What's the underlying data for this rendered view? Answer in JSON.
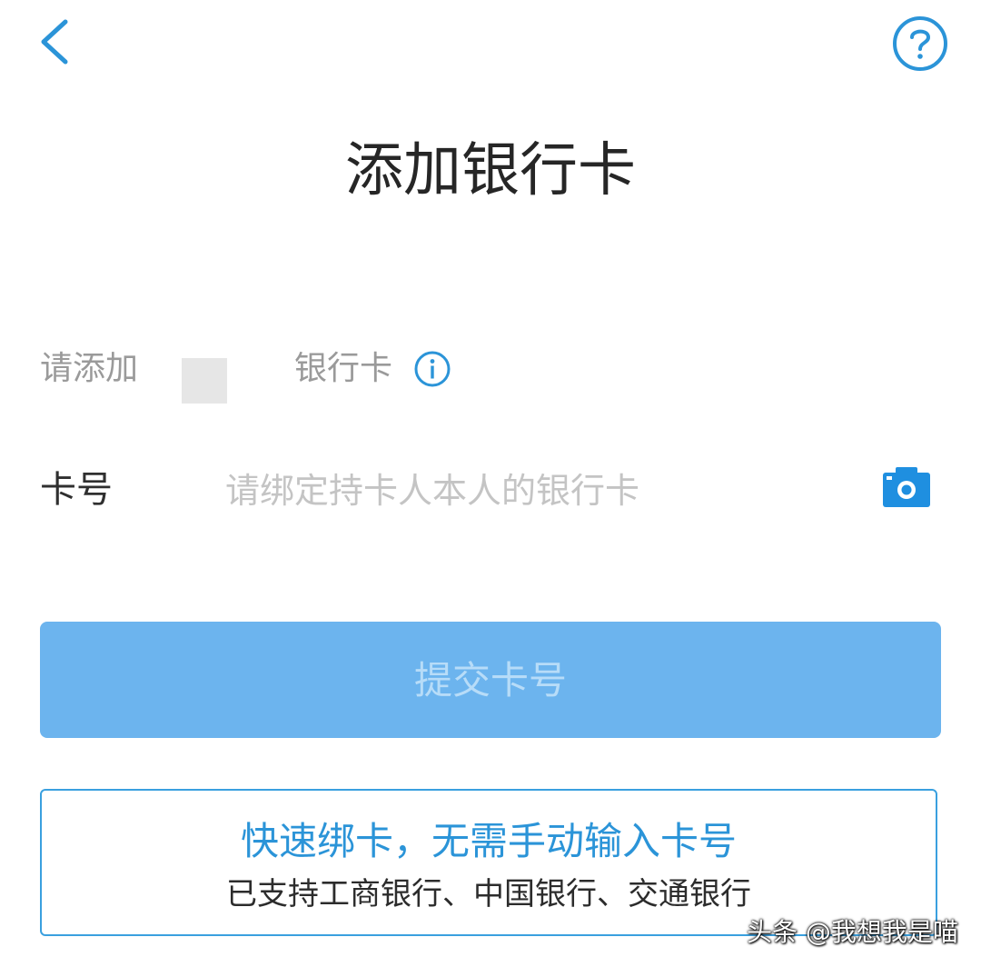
{
  "header": {
    "title": "添加银行卡",
    "back_icon": "chevron-left-icon",
    "help_icon": "question-circle-icon"
  },
  "hint": {
    "left_text": "请添加",
    "right_text": "银行卡",
    "info_icon": "info-circle-icon"
  },
  "card_field": {
    "label": "卡号",
    "value": "",
    "placeholder": "请绑定持卡人本人的银行卡",
    "camera_icon": "camera-icon"
  },
  "submit": {
    "label": "提交卡号"
  },
  "quick_bind": {
    "title": "快速绑卡，无需手动输入卡号",
    "subtitle": "已支持工商银行、中国银行、交通银行"
  },
  "watermark": {
    "text": "头条 @我想我是喵"
  },
  "colors": {
    "accent": "#2b94d8",
    "button_bg": "#6cb4ee",
    "button_text": "#b7dcf8",
    "hint_text": "#9a9a9a",
    "placeholder": "#c4c4c4"
  }
}
